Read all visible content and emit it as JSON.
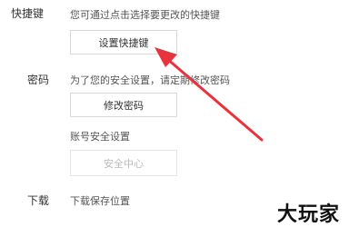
{
  "shortcut": {
    "label": "快捷键",
    "description": "您可通过点击选择要更改的快捷键",
    "button_label": "设置快捷键"
  },
  "password": {
    "label": "密码",
    "description": "为了您的安全设置，请定期修改密码",
    "button_label": "修改密码",
    "account_security_label": "账号安全设置",
    "security_center_label": "安全中心"
  },
  "download": {
    "label": "下载",
    "description": "下载保存位置"
  },
  "watermark": {
    "text": "大玩家"
  },
  "colors": {
    "annotation_arrow": "#e8323c"
  }
}
